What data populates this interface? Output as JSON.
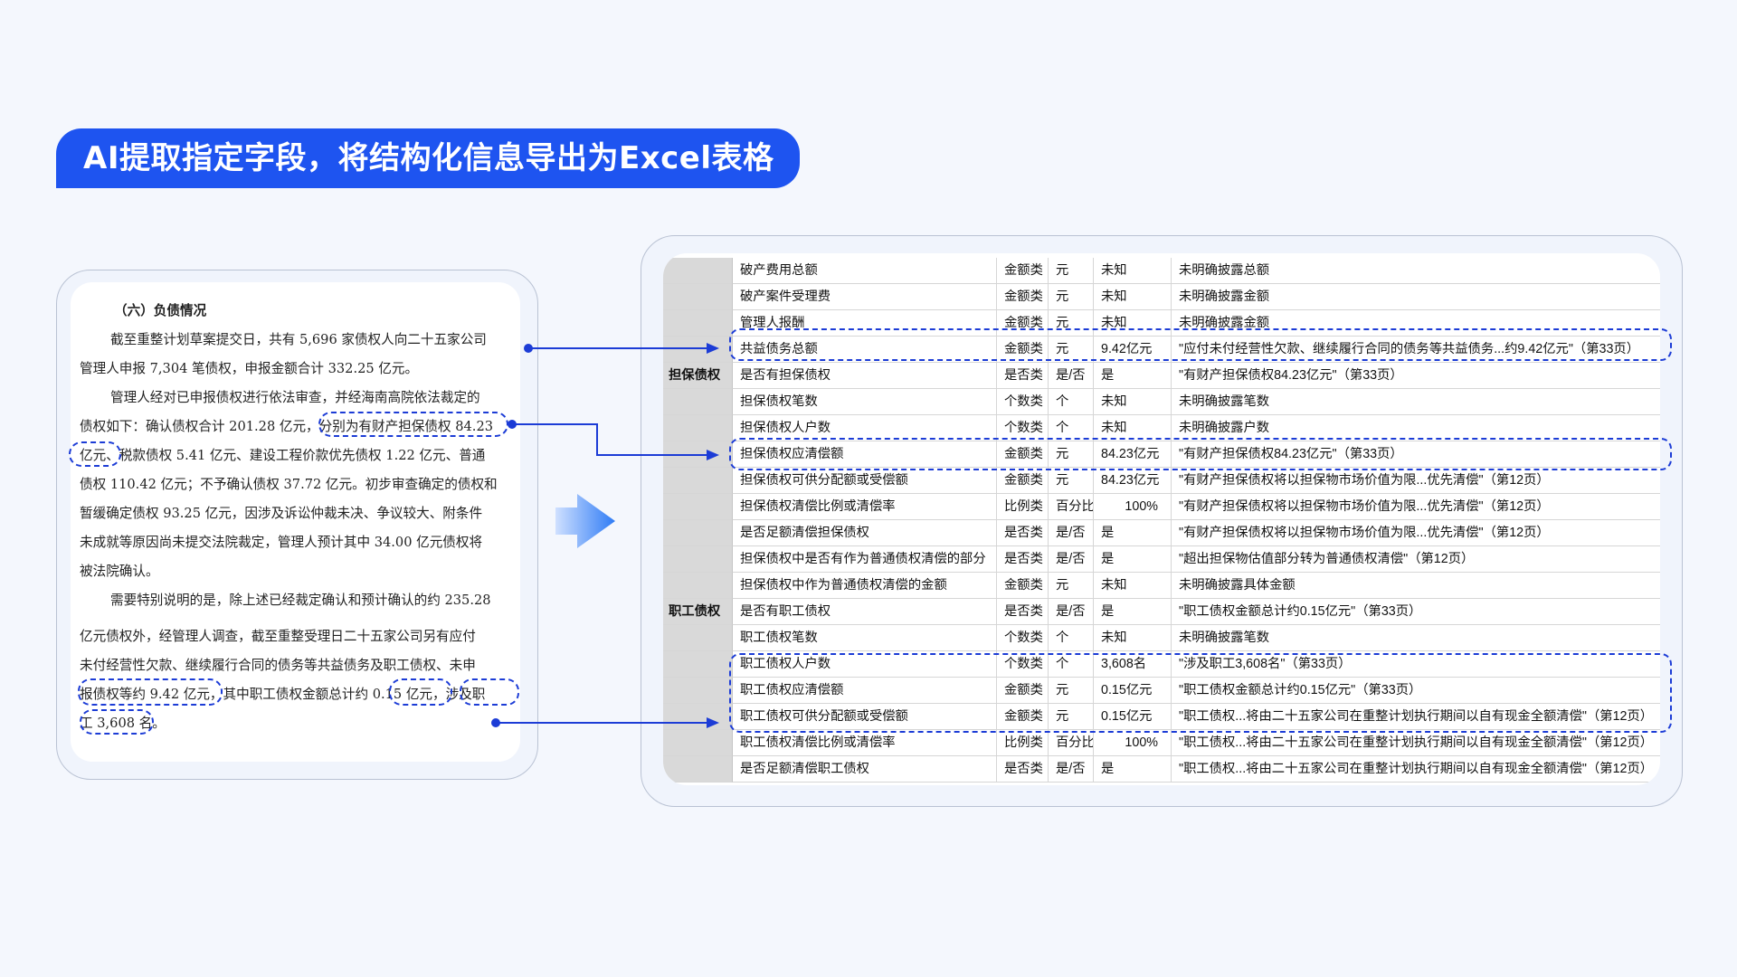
{
  "banner": {
    "title": "AI提取指定字段，将结构化信息导出为Excel表格"
  },
  "document": {
    "heading": "（六）负债情况",
    "lines": [
      "截至重整计划草案提交日，共有 5,696 家债权人向二十五家公司",
      "管理人申报 7,304 笔债权，申报金额合计 332.25 亿元。",
      "管理人经对已申报债权进行依法审查，并经海南高院依法裁定的",
      "债权如下：确认债权合计 201.28 亿元，分别为有财产担保债权 84.23",
      "亿元、税款债权 5.41 亿元、建设工程价款优先债权 1.22 亿元、普通",
      "债权 110.42 亿元；不予确认债权 37.72 亿元。初步审查确定的债权和",
      "暂缓确定债权 93.25 亿元，因涉及诉讼仲裁未决、争议较大、附条件",
      "未成就等原因尚未提交法院裁定，管理人预计其中 34.00 亿元债权将",
      "被法院确认。",
      "需要特别说明的是，除上述已经裁定确认和预计确认的约 235.28",
      "亿元债权外，经管理人调查，截至重整受理日二十五家公司另有应付",
      "未付经营性欠款、继续履行合同的债务等共益债务及职工债权、未申",
      "报债权等约 9.42 亿元，其中职工债权金额总计约 0.15 亿元，涉及职",
      "工 3,608 名。"
    ]
  },
  "table": {
    "rows": [
      {
        "group": "",
        "field": "破产费用总额",
        "type": "金额类",
        "unit": "元",
        "value": "未知",
        "source": "未明确披露总额"
      },
      {
        "group": "",
        "field": "破产案件受理费",
        "type": "金额类",
        "unit": "元",
        "value": "未知",
        "source": "未明确披露金额"
      },
      {
        "group": "",
        "field": "管理人报酬",
        "type": "金额类",
        "unit": "元",
        "value": "未知",
        "source": "未明确披露金额"
      },
      {
        "group": "",
        "field": "共益债务总额",
        "type": "金额类",
        "unit": "元",
        "value": "9.42亿元",
        "source": "\"应付未付经营性欠款、继续履行合同的债务等共益债务...约9.42亿元\"（第33页）"
      },
      {
        "group": "担保债权",
        "field": "是否有担保债权",
        "type": "是否类",
        "unit": "是/否",
        "value": "是",
        "source": "\"有财产担保债权84.23亿元\"（第33页）"
      },
      {
        "group": "",
        "field": "担保债权笔数",
        "type": "个数类",
        "unit": "个",
        "value": "未知",
        "source": "未明确披露笔数"
      },
      {
        "group": "",
        "field": "担保债权人户数",
        "type": "个数类",
        "unit": "个",
        "value": "未知",
        "source": "未明确披露户数"
      },
      {
        "group": "",
        "field": "担保债权应清偿额",
        "type": "金额类",
        "unit": "元",
        "value": "84.23亿元",
        "source": "\"有财产担保债权84.23亿元\"（第33页）"
      },
      {
        "group": "",
        "field": "担保债权可供分配额或受偿额",
        "type": "金额类",
        "unit": "元",
        "value": "84.23亿元",
        "source": "\"有财产担保债权将以担保物市场价值为限...优先清偿\"（第12页）"
      },
      {
        "group": "",
        "field": "担保债权清偿比例或清偿率",
        "type": "比例类",
        "unit": "百分比",
        "value": "100%",
        "source": "\"有财产担保债权将以担保物市场价值为限...优先清偿\"（第12页）"
      },
      {
        "group": "",
        "field": "是否足额清偿担保债权",
        "type": "是否类",
        "unit": "是/否",
        "value": "是",
        "source": "\"有财产担保债权将以担保物市场价值为限...优先清偿\"（第12页）"
      },
      {
        "group": "",
        "field": "担保债权中是否有作为普通债权清偿的部分",
        "type": "是否类",
        "unit": "是/否",
        "value": "是",
        "source": "\"超出担保物估值部分转为普通债权清偿\"（第12页）"
      },
      {
        "group": "",
        "field": "担保债权中作为普通债权清偿的金额",
        "type": "金额类",
        "unit": "元",
        "value": "未知",
        "source": "未明确披露具体金额"
      },
      {
        "group": "职工债权",
        "field": "是否有职工债权",
        "type": "是否类",
        "unit": "是/否",
        "value": "是",
        "source": "\"职工债权金额总计约0.15亿元\"（第33页）"
      },
      {
        "group": "",
        "field": "职工债权笔数",
        "type": "个数类",
        "unit": "个",
        "value": "未知",
        "source": "未明确披露笔数"
      },
      {
        "group": "",
        "field": "职工债权人户数",
        "type": "个数类",
        "unit": "个",
        "value": "3,608名",
        "source": "\"涉及职工3,608名\"（第33页）"
      },
      {
        "group": "",
        "field": "职工债权应清偿额",
        "type": "金额类",
        "unit": "元",
        "value": "0.15亿元",
        "source": "\"职工债权金额总计约0.15亿元\"（第33页）"
      },
      {
        "group": "",
        "field": "职工债权可供分配额或受偿额",
        "type": "金额类",
        "unit": "元",
        "value": "0.15亿元",
        "source": "\"职工债权...将由二十五家公司在重整计划执行期间以自有现金全额清偿\"（第12页）"
      },
      {
        "group": "",
        "field": "职工债权清偿比例或清偿率",
        "type": "比例类",
        "unit": "百分比",
        "value": "100%",
        "source": "\"职工债权...将由二十五家公司在重整计划执行期间以自有现金全额清偿\"（第12页）"
      },
      {
        "group": "",
        "field": "是否足额清偿职工债权",
        "type": "是否类",
        "unit": "是/否",
        "value": "是",
        "source": "\"职工债权...将由二十五家公司在重整计划执行期间以自有现金全额清偿\"（第12页）"
      }
    ]
  },
  "colors": {
    "accent": "#1e54f0",
    "dash": "#1c3cd6",
    "group_bg": "#d9d9d9"
  }
}
